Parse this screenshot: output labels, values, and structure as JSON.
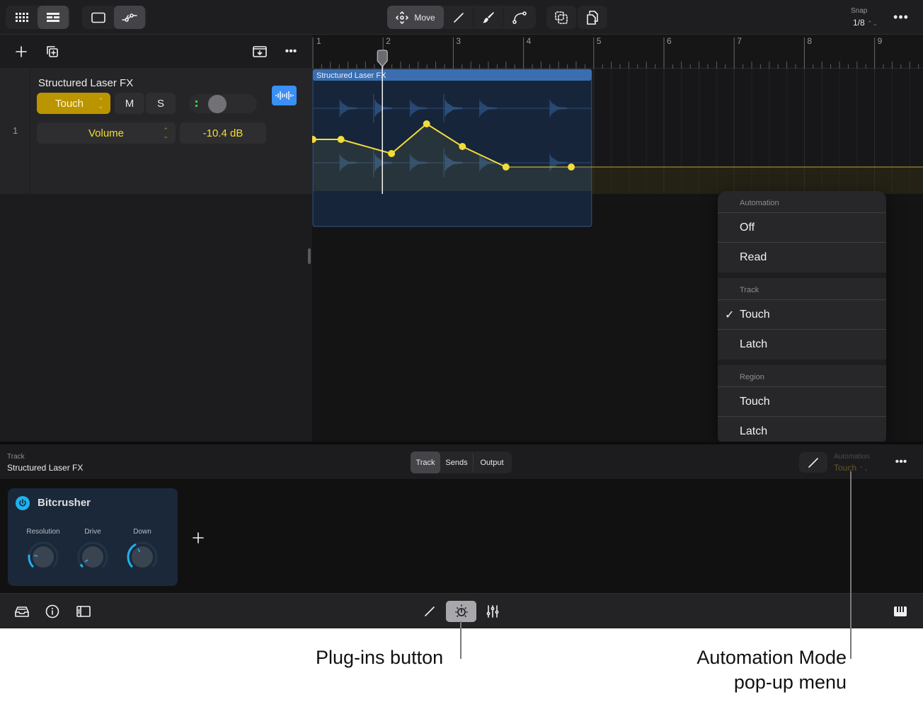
{
  "toolbar": {
    "view_modes": [
      "grid-view",
      "tracks-view"
    ],
    "edit_modes": [
      "region-mode",
      "automation-mode"
    ],
    "tools": {
      "move_label": "Move",
      "items": [
        "move-tool",
        "pencil-tool",
        "brush-tool",
        "curve-tool"
      ]
    },
    "snap_label": "Snap",
    "snap_value": "1/8"
  },
  "track": {
    "number": "1",
    "name": "Structured Laser FX",
    "automation_mode": "Touch",
    "mute_label": "M",
    "solo_label": "S",
    "parameter": "Volume",
    "parameter_value": "-10.4 dB"
  },
  "ruler": {
    "bars": [
      "1",
      "2",
      "3",
      "4",
      "5",
      "6",
      "7",
      "8",
      "9"
    ]
  },
  "region": {
    "name": "Structured Laser FX",
    "color": "#3a6eb0"
  },
  "automation_line": {
    "color": "#f2dc3a",
    "points_bar_value": [
      [
        1.0,
        0.55
      ],
      [
        1.4,
        0.55
      ],
      [
        2.12,
        0.35
      ],
      [
        2.62,
        0.77
      ],
      [
        3.13,
        0.45
      ],
      [
        3.75,
        0.16
      ],
      [
        4.68,
        0.16
      ]
    ]
  },
  "playhead_bar": 1.99,
  "automation_menu": {
    "sections": [
      {
        "header": "Automation",
        "items": [
          {
            "label": "Off",
            "checked": false
          },
          {
            "label": "Read",
            "checked": false
          }
        ]
      },
      {
        "header": "Track",
        "items": [
          {
            "label": "Touch",
            "checked": true
          },
          {
            "label": "Latch",
            "checked": false
          }
        ]
      },
      {
        "header": "Region",
        "items": [
          {
            "label": "Touch",
            "checked": false
          },
          {
            "label": "Latch",
            "checked": false
          }
        ]
      }
    ],
    "check_glyph": "✓"
  },
  "inspector": {
    "caption": "Track",
    "track_name": "Structured Laser FX",
    "tabs": [
      {
        "label": "Track",
        "active": true
      },
      {
        "label": "Sends",
        "active": false
      },
      {
        "label": "Output",
        "active": false
      }
    ],
    "automation_caption": "Automation",
    "automation_value": "Touch",
    "plugin": {
      "name": "Bitcrusher",
      "accent": "#1fb2f0",
      "knobs": [
        {
          "label": "Resolution",
          "value": 0.2
        },
        {
          "label": "Drive",
          "value": 0.05
        },
        {
          "label": "Down",
          "value": 0.4
        }
      ]
    },
    "add_plugin_label": "+"
  },
  "bottombar": {
    "left": [
      "browser-icon",
      "info-icon",
      "inspector-toggle-icon"
    ],
    "center": [
      "editor-pencil-icon",
      "plugins-icon",
      "mixer-icon"
    ],
    "right": [
      "keyboard-icon"
    ]
  },
  "callouts": {
    "plugins": "Plug-ins button",
    "automation_line1": "Automation Mode",
    "automation_line2": "pop-up menu"
  }
}
